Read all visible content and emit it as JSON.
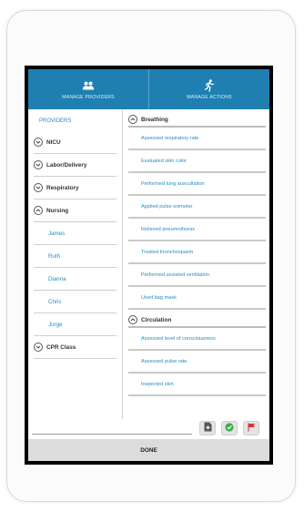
{
  "header": {
    "tab_providers": "MANAGE PROVIDERS",
    "tab_actions": "MANAGE ACTIONS"
  },
  "providers": {
    "heading": "PROVIDERS",
    "groups": {
      "nicu": "NICU",
      "labor": "Labor/Delivery",
      "respiratory": "Respiratory",
      "nursing": "Nursing",
      "cpr": "CPR Class"
    },
    "nursing_members": [
      "James",
      "Ruth",
      "Dianna",
      "Chris",
      "Jorge"
    ]
  },
  "actions": {
    "breathing": {
      "title": "Breathing",
      "items": [
        "Assessed respiratory rate",
        "Evaluated skin color",
        "Performed lung auscultation",
        "Applied pulse oximeter",
        "Relieved pneumothorax",
        "Treated bronchospasm",
        "Performed assisted ventilation",
        "Used bag mask"
      ]
    },
    "circulation": {
      "title": "Circulation",
      "items": [
        "Assessed level of consciousness",
        "Assessed pulse rate",
        "Inspected skin"
      ]
    }
  },
  "footer": {
    "done_label": "DONE"
  },
  "colors": {
    "header_bg": "#1f7fb0",
    "link_blue": "#2a8cc1",
    "check_green": "#3db04a",
    "flag_red": "#d93636"
  }
}
